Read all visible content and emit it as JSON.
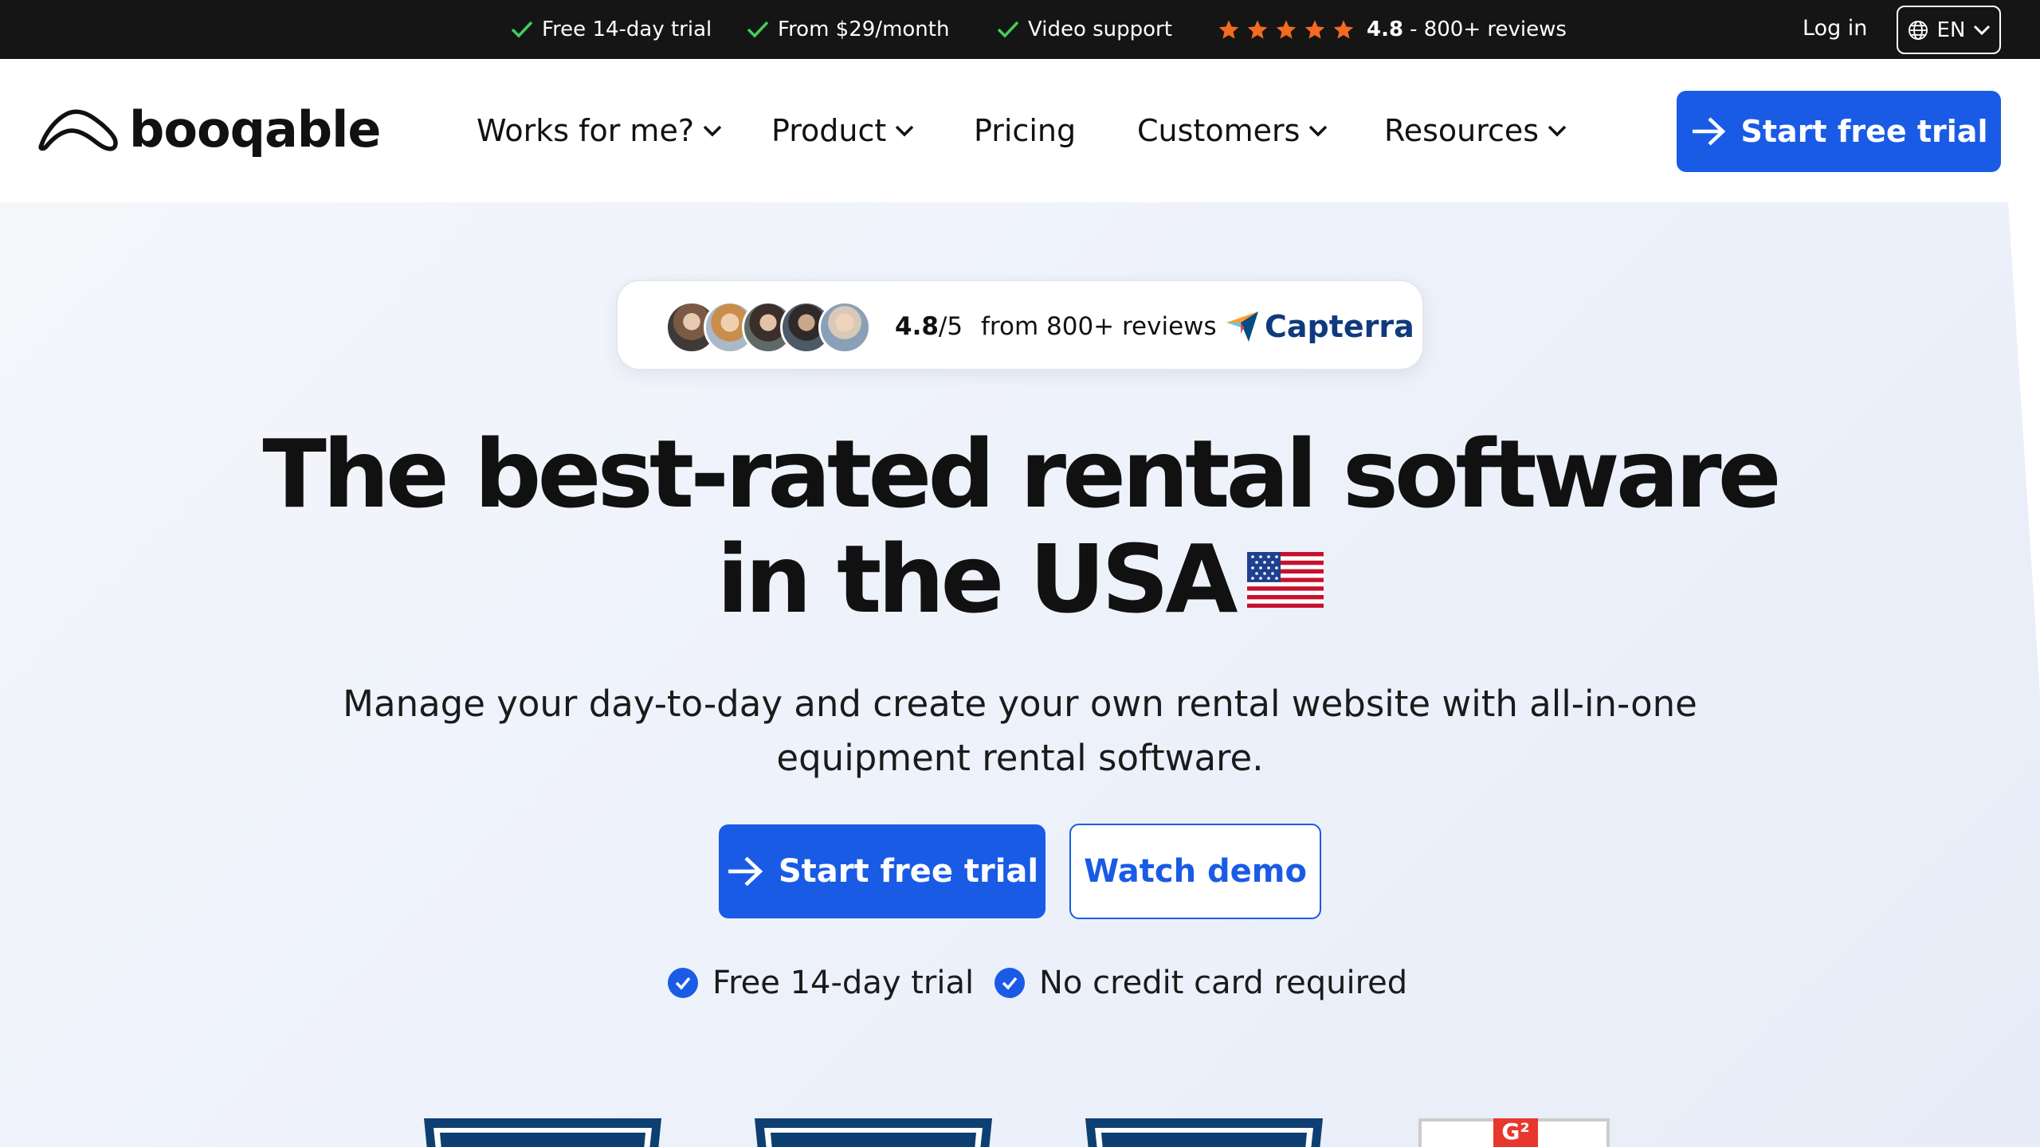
{
  "topbar": {
    "usps": [
      "Free 14-day trial",
      "From $29/month",
      "Video support"
    ],
    "rating_score": "4.8",
    "rating_text": "- 800+ reviews",
    "login": "Log in",
    "language": "EN"
  },
  "nav": {
    "brand": "booqable",
    "items": [
      "Works for me?",
      "Product",
      "Pricing",
      "Customers",
      "Resources"
    ],
    "cta": "Start free trial"
  },
  "hero": {
    "review_score": "4.8",
    "review_scale": "/5",
    "review_from": "from 800+ reviews",
    "review_source": "Capterra",
    "headline_line1": "The best-rated rental software",
    "headline_line2": "in the USA",
    "subline": "Manage your day-to-day and create your own rental website with all-in-one equipment rental software.",
    "cta_primary": "Start free trial",
    "cta_secondary": "Watch demo",
    "checks": [
      "Free 14-day trial",
      "No credit card required"
    ]
  },
  "colors": {
    "accent": "#1a5be6",
    "topbar": "#151515",
    "star": "#f26b21",
    "check_green": "#3fcf5e"
  }
}
